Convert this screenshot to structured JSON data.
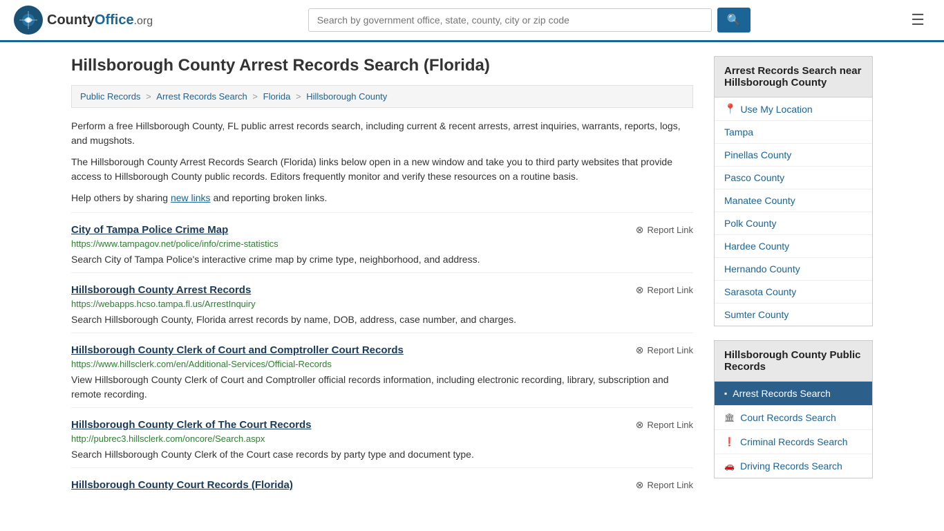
{
  "header": {
    "logo_text": "CountyOffice",
    "logo_tld": ".org",
    "search_placeholder": "Search by government office, state, county, city or zip code",
    "menu_label": "Menu"
  },
  "page": {
    "title": "Hillsborough County Arrest Records Search (Florida)"
  },
  "breadcrumb": {
    "items": [
      {
        "label": "Public Records",
        "href": "#"
      },
      {
        "label": "Arrest Records Search",
        "href": "#"
      },
      {
        "label": "Florida",
        "href": "#"
      },
      {
        "label": "Hillsborough County",
        "href": "#"
      }
    ]
  },
  "description": [
    "Perform a free Hillsborough County, FL public arrest records search, including current & recent arrests, arrest inquiries, warrants, reports, logs, and mugshots.",
    "The Hillsborough County Arrest Records Search (Florida) links below open in a new window and take you to third party websites that provide access to Hillsborough County public records. Editors frequently monitor and verify these resources on a routine basis."
  ],
  "help_text_before": "Help others by sharing ",
  "help_link": "new links",
  "help_text_after": " and reporting broken links.",
  "links": [
    {
      "title": "City of Tampa Police Crime Map",
      "url": "https://www.tampagov.net/police/info/crime-statistics",
      "description": "Search City of Tampa Police's interactive crime map by crime type, neighborhood, and address.",
      "report_label": "Report Link"
    },
    {
      "title": "Hillsborough County Arrest Records",
      "url": "https://webapps.hcso.tampa.fl.us/ArrestInquiry",
      "description": "Search Hillsborough County, Florida arrest records by name, DOB, address, case number, and charges.",
      "report_label": "Report Link"
    },
    {
      "title": "Hillsborough County Clerk of Court and Comptroller Court Records",
      "url": "https://www.hillsclerk.com/en/Additional-Services/Official-Records",
      "description": "View Hillsborough County Clerk of Court and Comptroller official records information, including electronic recording, library, subscription and remote recording.",
      "report_label": "Report Link"
    },
    {
      "title": "Hillsborough County Clerk of The Court Records",
      "url": "http://pubrec3.hillsclerk.com/oncore/Search.aspx",
      "description": "Search Hillsborough County Clerk of the Court case records by party type and document type.",
      "report_label": "Report Link"
    },
    {
      "title": "Hillsborough County Court Records (Florida)",
      "url": "",
      "description": "",
      "report_label": "Report Link"
    }
  ],
  "sidebar": {
    "near_title": "Arrest Records Search near Hillsborough County",
    "use_location_label": "Use My Location",
    "near_items": [
      {
        "label": "Tampa",
        "href": "#"
      },
      {
        "label": "Pinellas County",
        "href": "#"
      },
      {
        "label": "Pasco County",
        "href": "#"
      },
      {
        "label": "Manatee County",
        "href": "#"
      },
      {
        "label": "Polk County",
        "href": "#"
      },
      {
        "label": "Hardee County",
        "href": "#"
      },
      {
        "label": "Hernando County",
        "href": "#"
      },
      {
        "label": "Sarasota County",
        "href": "#"
      },
      {
        "label": "Sumter County",
        "href": "#"
      }
    ],
    "records_title": "Hillsborough County Public Records",
    "record_items": [
      {
        "label": "Arrest Records Search",
        "icon": "▪",
        "active": true
      },
      {
        "label": "Court Records Search",
        "icon": "🏛",
        "active": false
      },
      {
        "label": "Criminal Records Search",
        "icon": "❗",
        "active": false
      },
      {
        "label": "Driving Records Search",
        "icon": "🚗",
        "active": false
      }
    ]
  }
}
